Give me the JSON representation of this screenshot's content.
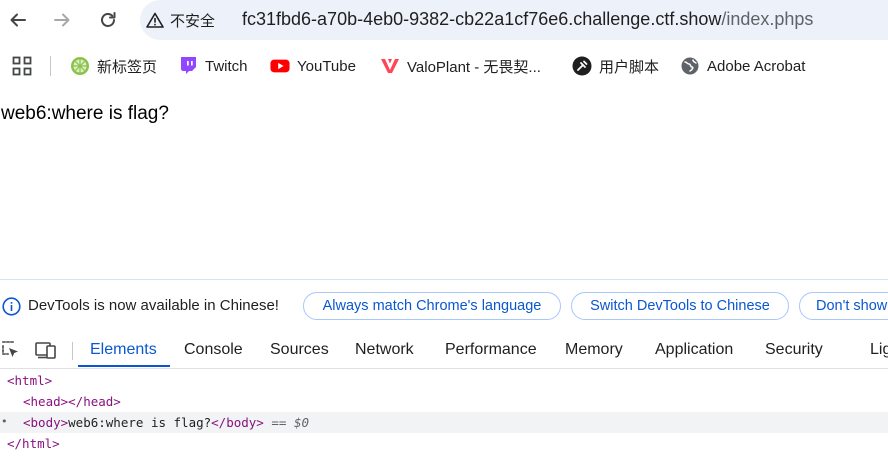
{
  "browser": {
    "security_label": "不安全",
    "url_host": "fc31fbd6-a70b-4eb0-9382-cb22a1cf76e6.challenge.ctf.show",
    "url_path": "/index.phps"
  },
  "bookmarks": [
    {
      "label": "新标签页",
      "icon": "lime-icon"
    },
    {
      "label": "Twitch",
      "icon": "twitch-icon"
    },
    {
      "label": "YouTube",
      "icon": "youtube-icon"
    },
    {
      "label": "ValoPlant - 无畏契...",
      "icon": "valoplant-icon"
    },
    {
      "label": "用户脚本",
      "icon": "userscript-icon"
    },
    {
      "label": "Adobe Acrobat",
      "icon": "globe-icon"
    }
  ],
  "page": {
    "body_text": "web6:where is flag?"
  },
  "devtools": {
    "info_text": "DevTools is now available in Chinese!",
    "buttons": [
      "Always match Chrome's language",
      "Switch DevTools to Chinese",
      "Don't show"
    ],
    "tabs": [
      "Elements",
      "Console",
      "Sources",
      "Network",
      "Performance",
      "Memory",
      "Application",
      "Security",
      "Lig"
    ],
    "active_tab": "Elements",
    "dom": {
      "html_open": "<html>",
      "head": "<head></head>",
      "body_open": "<body>",
      "body_text": "web6:where is flag?",
      "body_close": "</body>",
      "selected_marker": "== $0",
      "html_close": "</html>"
    }
  },
  "colors": {
    "accent": "#0b57d0",
    "omnibox_bg": "#edf2fa",
    "tag": "#881280"
  }
}
